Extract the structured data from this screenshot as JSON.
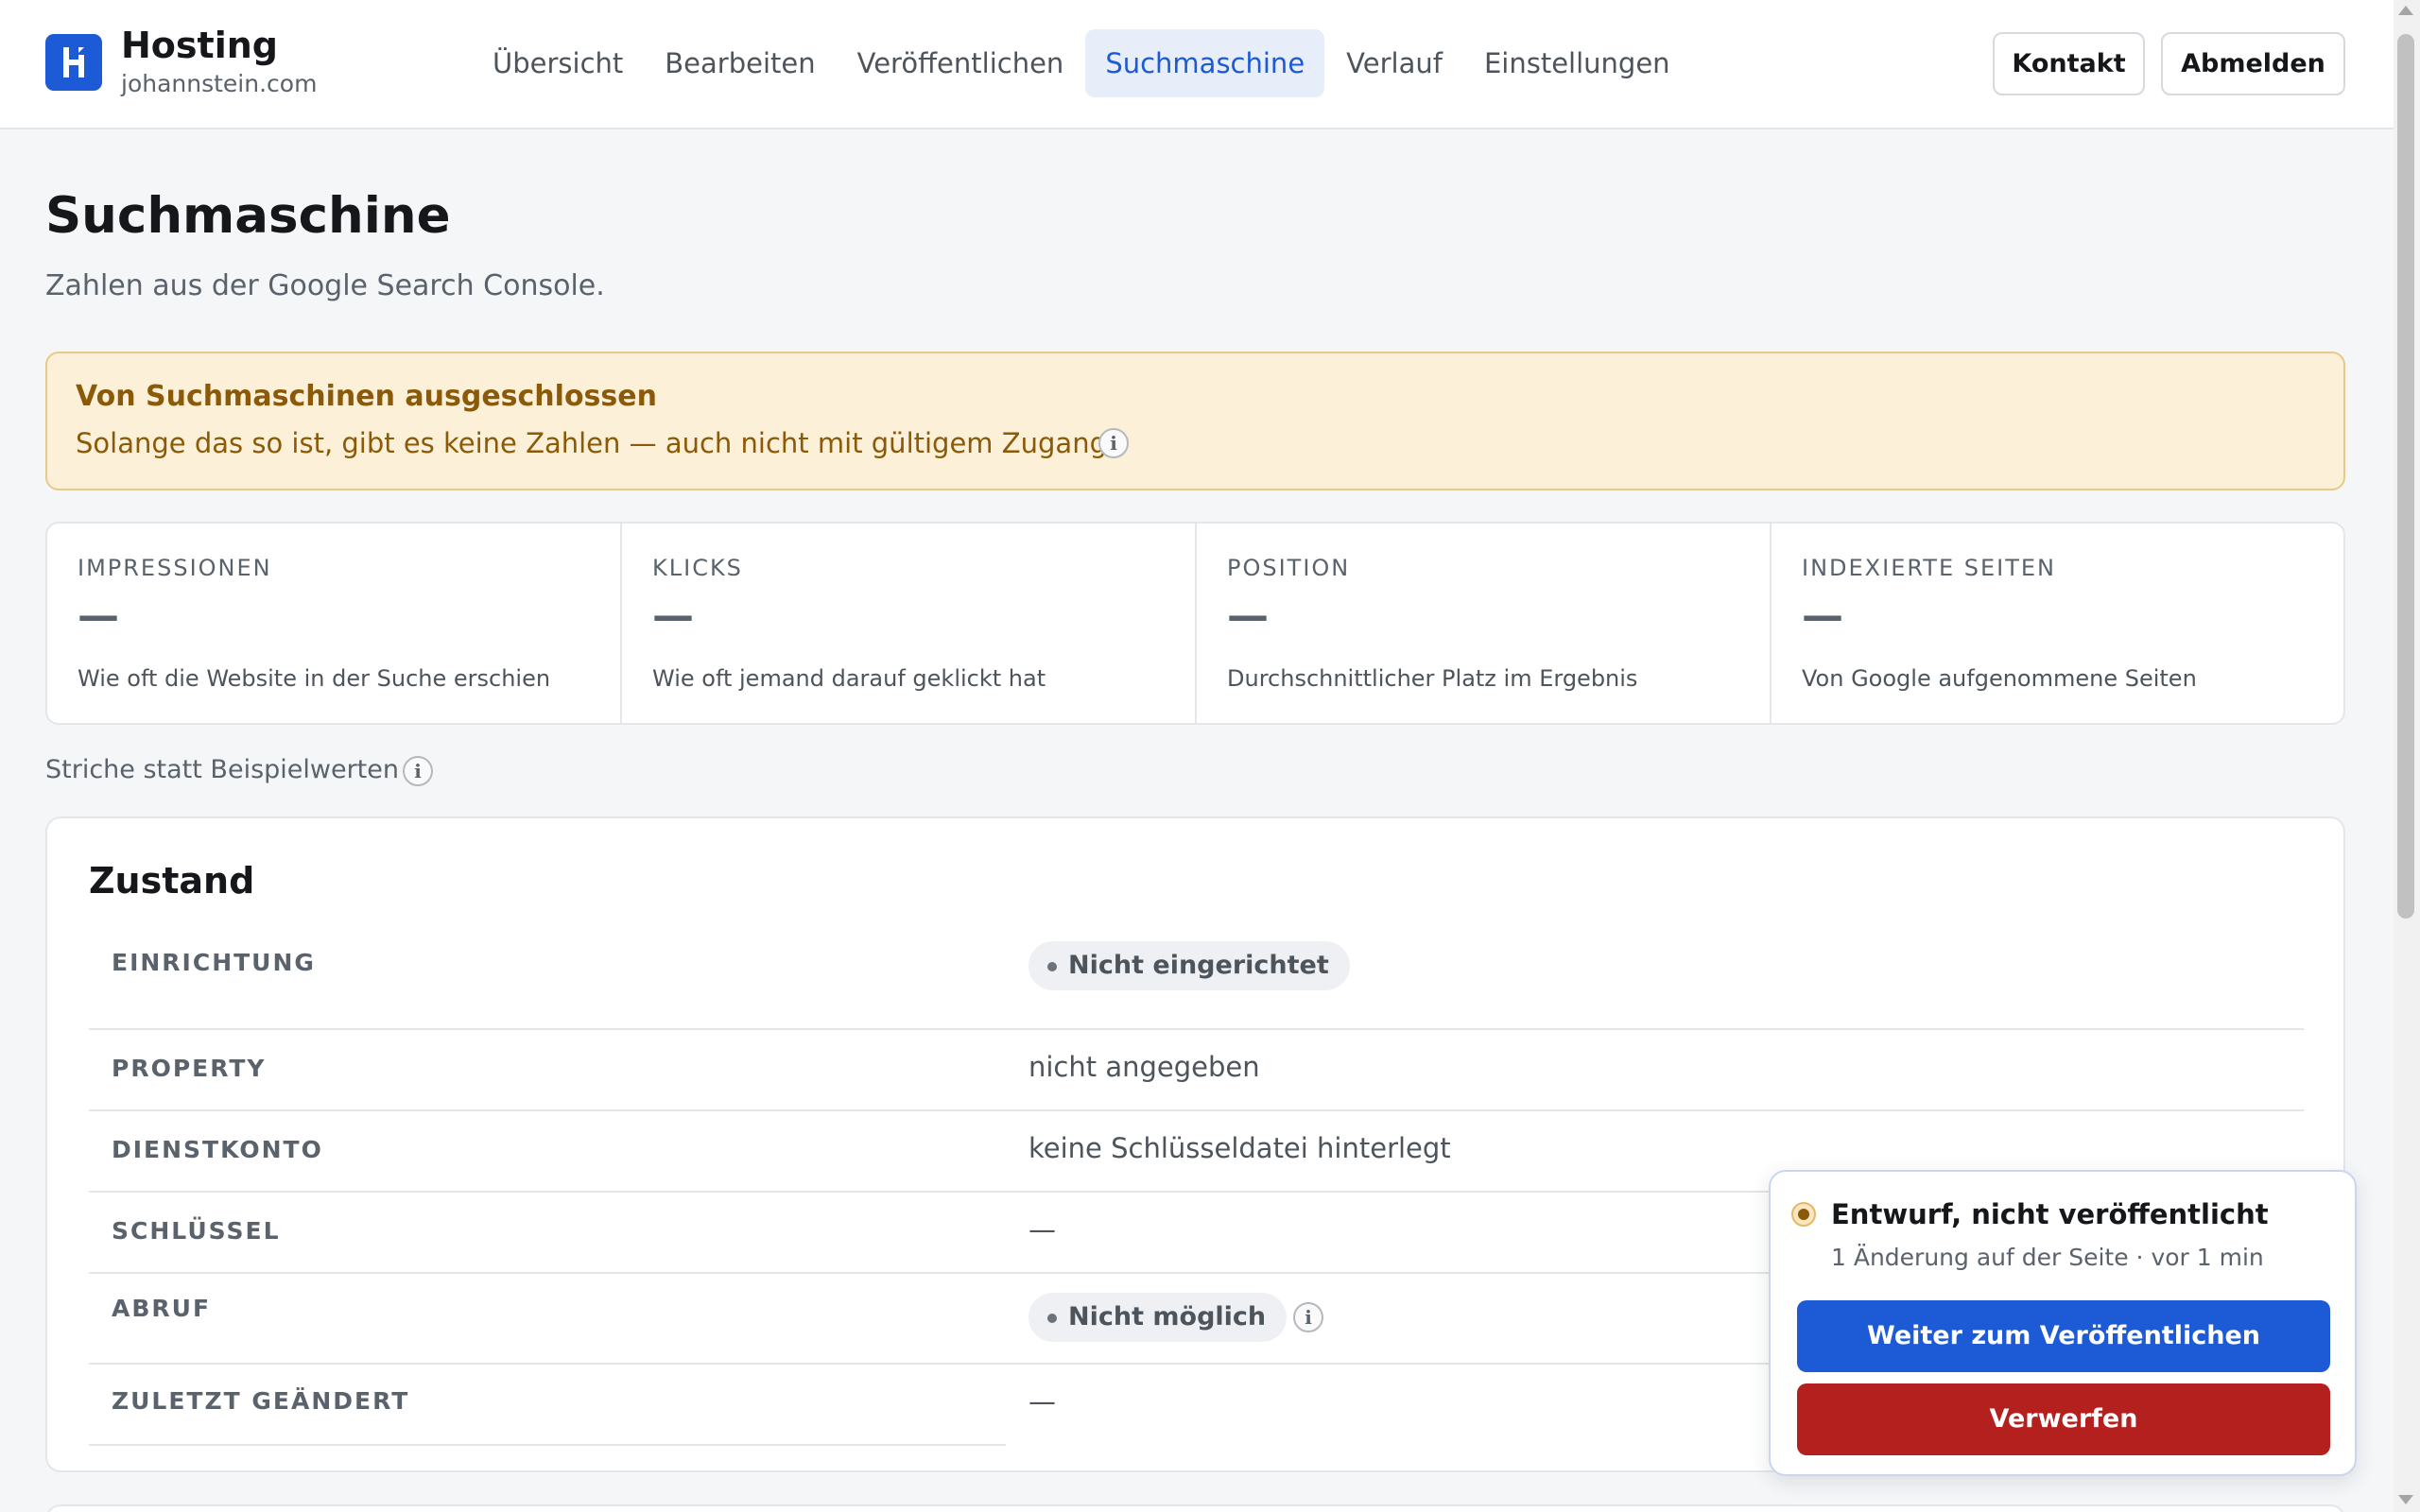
{
  "header": {
    "brand_title": "Hosting",
    "brand_domain": "johannstein.com",
    "logo_icon": "h-logo-icon",
    "nav": [
      {
        "label": "Übersicht",
        "active": false
      },
      {
        "label": "Bearbeiten",
        "active": false
      },
      {
        "label": "Veröffentlichen",
        "active": false
      },
      {
        "label": "Suchmaschine",
        "active": true
      },
      {
        "label": "Verlauf",
        "active": false
      },
      {
        "label": "Einstellungen",
        "active": false
      }
    ],
    "contact_label": "Kontakt",
    "logout_label": "Abmelden"
  },
  "page": {
    "title": "Suchmaschine",
    "subtitle": "Zahlen aus der Google Search Console."
  },
  "warning": {
    "title": "Von Suchmaschinen ausgeschlossen",
    "text": "Solange das so ist, gibt es keine Zahlen — auch nicht mit gültigem Zugang.",
    "info_glyph": "i"
  },
  "stats": [
    {
      "label": "IMPRESSIONEN",
      "value": "—",
      "desc": "Wie oft die Website in der Suche erschien"
    },
    {
      "label": "KLICKS",
      "value": "—",
      "desc": "Wie oft jemand darauf geklickt hat"
    },
    {
      "label": "POSITION",
      "value": "—",
      "desc": "Durchschnittlicher Platz im Ergebnis"
    },
    {
      "label": "INDEXIERTE SEITEN",
      "value": "—",
      "desc": "Von Google aufgenommene Seiten"
    }
  ],
  "dash_note": "Striche statt Beispielwerten",
  "status": {
    "title": "Zustand",
    "rows": [
      {
        "label": "EINRICHTUNG",
        "value": "Nicht eingerichtet"
      },
      {
        "label": "PROPERTY",
        "value": "nicht angegeben"
      },
      {
        "label": "DIENSTKONTO",
        "value": "keine Schlüsseldatei hinterlegt"
      },
      {
        "label": "SCHLÜSSEL",
        "value": "—"
      },
      {
        "label": "ABRUF",
        "value": "Nicht möglich"
      },
      {
        "label": "ZULETZT GEÄNDERT",
        "value": "—"
      }
    ]
  },
  "draft": {
    "title": "Entwurf, nicht veröffentlicht",
    "meta": "1 Änderung auf der Seite · vor 1 min",
    "publish_label": "Weiter zum Veröffentlichen",
    "discard_label": "Verwerfen"
  },
  "colors": {
    "accent": "#1d5ad6",
    "warning_bg": "#fdf0d8",
    "warning_text": "#8a5a08",
    "danger": "#b3201e"
  }
}
